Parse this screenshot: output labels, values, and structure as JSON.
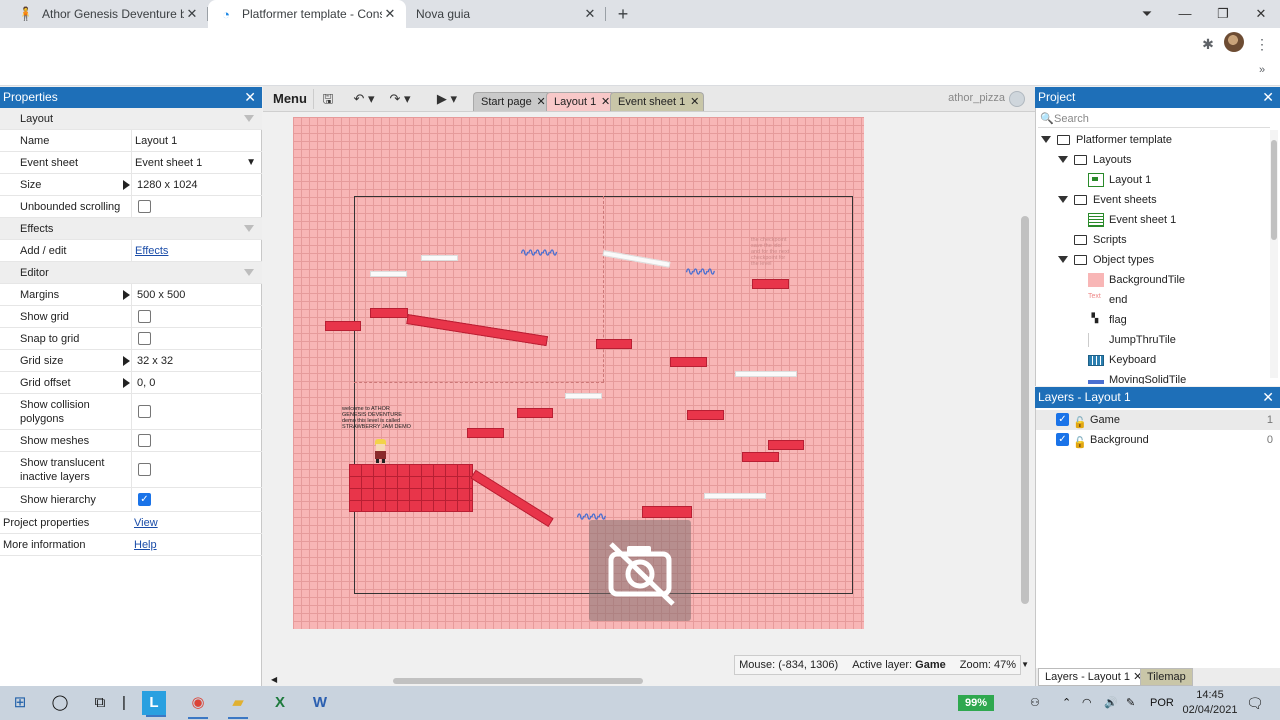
{
  "browser": {
    "tabs": [
      {
        "title": "Athor Genesis Deventure by athc",
        "active": false
      },
      {
        "title": "Platformer template - Construct",
        "active": true
      },
      {
        "title": "Nova guia",
        "active": false
      }
    ]
  },
  "properties": {
    "title": "Properties",
    "rows": [
      {
        "kind": "section",
        "label": "Layout"
      },
      {
        "kind": "text",
        "label": "Name",
        "value": "Layout 1"
      },
      {
        "kind": "select",
        "label": "Event sheet",
        "value": "Event sheet 1"
      },
      {
        "kind": "expand",
        "label": "Size",
        "value": "1280 x 1024"
      },
      {
        "kind": "check",
        "label": "Unbounded scrolling",
        "checked": false
      },
      {
        "kind": "section",
        "label": "Effects"
      },
      {
        "kind": "link",
        "label": "Add / edit",
        "value": "Effects"
      },
      {
        "kind": "section",
        "label": "Editor"
      },
      {
        "kind": "expand",
        "label": "Margins",
        "value": "500 x 500"
      },
      {
        "kind": "check",
        "label": "Show grid",
        "checked": false
      },
      {
        "kind": "check",
        "label": "Snap to grid",
        "checked": false
      },
      {
        "kind": "expand",
        "label": "Grid size",
        "value": "32 x 32"
      },
      {
        "kind": "expand",
        "label": "Grid offset",
        "value": "0, 0"
      },
      {
        "kind": "check",
        "label": "Show collision polygons",
        "checked": false
      },
      {
        "kind": "check",
        "label": "Show meshes",
        "checked": false
      },
      {
        "kind": "check",
        "label": "Show translucent inactive layers",
        "checked": false
      },
      {
        "kind": "check",
        "label": "Show hierarchy",
        "checked": true
      },
      {
        "kind": "toplink",
        "label": "Project properties",
        "value": "View"
      },
      {
        "kind": "toplink",
        "label": "More information",
        "value": "Help"
      }
    ]
  },
  "editor": {
    "menu_label": "Menu",
    "tabs": [
      {
        "label": "Start page",
        "active": false
      },
      {
        "label": "Layout 1",
        "active": true
      },
      {
        "label": "Event sheet 1",
        "active": false
      }
    ],
    "username": "athor_pizza",
    "canvas_text": {
      "welcome": "welcome to ATHOR GENESIS DEVENTURE demo this level is called STRAWBERRY JAM DEMO",
      "faint_note": "the checkpoint save the idol and for the next checkpoint for the level"
    },
    "status": {
      "mouse": "Mouse: (-834, 1306)",
      "active_layer_label": "Active layer:",
      "active_layer": "Game",
      "zoom": "Zoom: 47%"
    }
  },
  "project": {
    "title": "Project",
    "search_placeholder": "Search",
    "tree": [
      {
        "label": "Platformer template",
        "depth": 0,
        "type": "folder",
        "expanded": true
      },
      {
        "label": "Layouts",
        "depth": 1,
        "type": "folder",
        "expanded": true
      },
      {
        "label": "Layout 1",
        "depth": 2,
        "type": "layout"
      },
      {
        "label": "Event sheets",
        "depth": 1,
        "type": "folder",
        "expanded": true
      },
      {
        "label": "Event sheet 1",
        "depth": 2,
        "type": "eventsheet"
      },
      {
        "label": "Scripts",
        "depth": 1,
        "type": "folder",
        "expanded": false
      },
      {
        "label": "Object types",
        "depth": 1,
        "type": "folder",
        "expanded": true
      },
      {
        "label": "BackgroundTile",
        "depth": 2,
        "type": "tile"
      },
      {
        "label": "end",
        "depth": 2,
        "type": "end"
      },
      {
        "label": "flag",
        "depth": 2,
        "type": "flag"
      },
      {
        "label": "JumpThruTile",
        "depth": 2,
        "type": "jumpthru"
      },
      {
        "label": "Keyboard",
        "depth": 2,
        "type": "keyboard"
      },
      {
        "label": "MovingSolidTile",
        "depth": 2,
        "type": "moving"
      }
    ]
  },
  "layers": {
    "title": "Layers - Layout 1",
    "items": [
      {
        "name": "Game",
        "number": "1",
        "selected": true
      },
      {
        "name": "Background",
        "number": "0",
        "selected": false
      }
    ],
    "bottom_tabs": [
      {
        "label": "Layers - Layout 1",
        "active": true
      },
      {
        "label": "Tilemap",
        "active": false
      }
    ]
  },
  "taskbar": {
    "battery": "99%",
    "language": "POR",
    "time": "14:45",
    "date": "02/04/2021"
  }
}
